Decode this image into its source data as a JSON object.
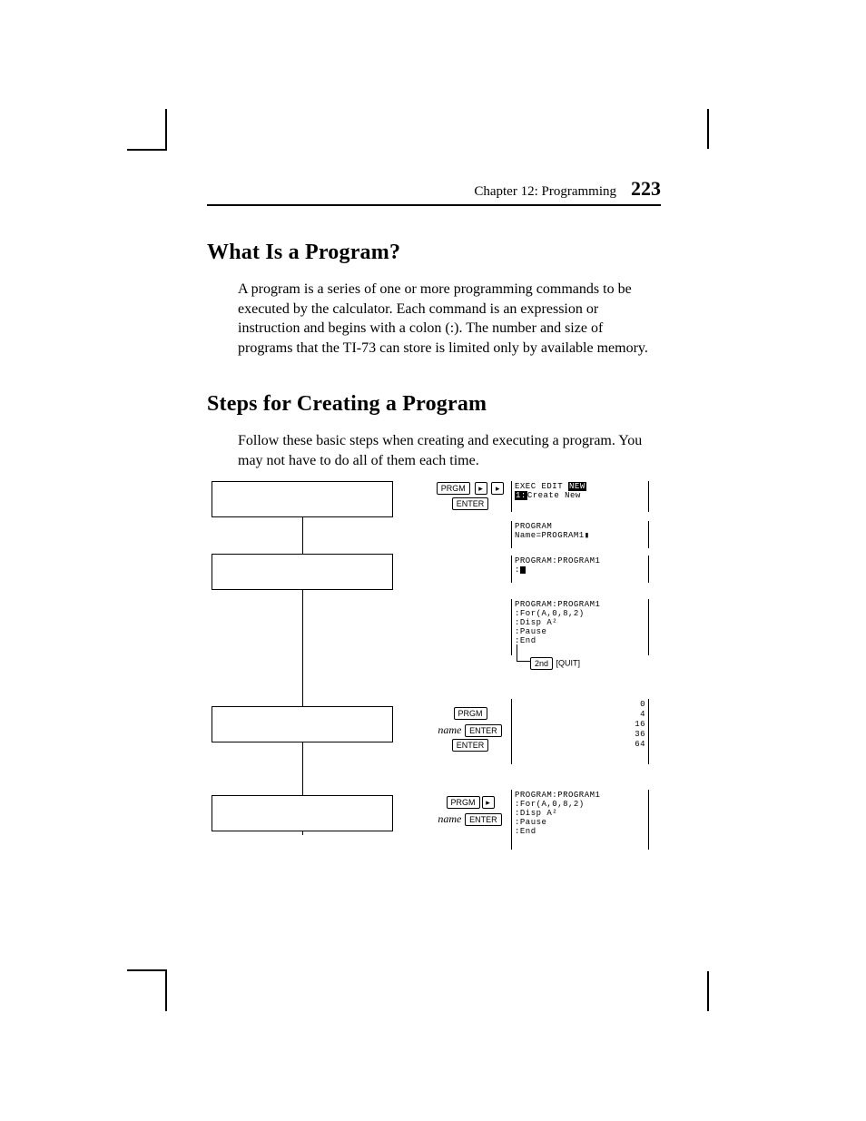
{
  "header": {
    "chapter": "Chapter 12: Programming",
    "page": "223"
  },
  "s1": {
    "title": "What Is a Program?",
    "body": "A program is a series of one or more programming commands to be executed by the calculator. Each command is an expression or instruction and begins with a colon (:). The number and size of programs that the TI-73 can store is limited only by available memory."
  },
  "s2": {
    "title": "Steps for Creating a Program",
    "body": "Follow these basic steps when creating and executing a program. You may not have to do all of them each time."
  },
  "keys": {
    "PRGM": "PRGM",
    "ENTER": "ENTER",
    "RIGHT": "▸",
    "SECOND": "2nd",
    "QUIT": "[QUIT]",
    "name": "name"
  },
  "screens": {
    "menu_top": "EXEC EDIT ",
    "menu_new": "NEW",
    "menu_item": "Create New",
    "name_prompt1": "PROGRAM",
    "name_prompt2": "Name=PROGRAM1",
    "prog_header": "PROGRAM:PROGRAM1",
    "prog_line_for": ":For(A,0,8,2)",
    "prog_line_disp": ":Disp A²",
    "prog_line_pause": ":Pause",
    "prog_line_end": ":End",
    "results": [
      "0",
      "4",
      "16",
      "36",
      "64"
    ]
  }
}
